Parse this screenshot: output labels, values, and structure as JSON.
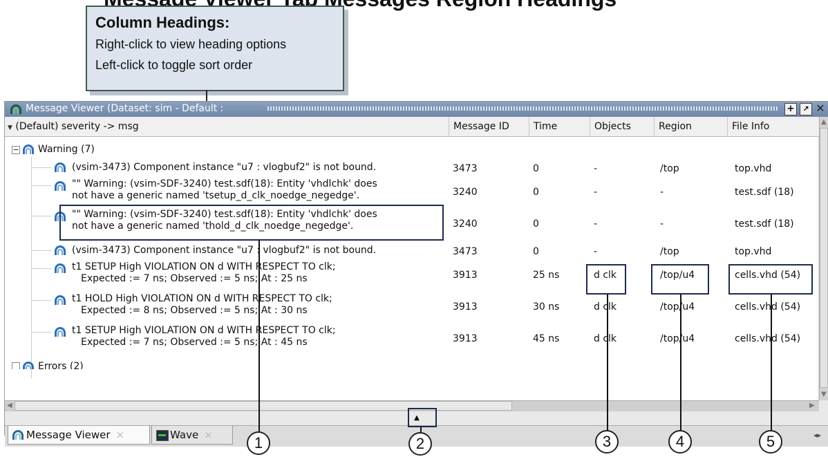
{
  "partial_heading": "Message Viewer Tab Messages Region Headings",
  "callout": {
    "title": "Column Headings:",
    "lines": [
      "Right-click to view heading options",
      "Left-click to toggle sort order"
    ]
  },
  "window": {
    "title": "Message Viewer (Dataset: sim - Default :",
    "buttons": {
      "add": "+",
      "restore": "↗",
      "close": "✕"
    }
  },
  "columns": [
    {
      "label": "(Default) severity -> msg"
    },
    {
      "label": "Message ID"
    },
    {
      "label": "Time"
    },
    {
      "label": "Objects"
    },
    {
      "label": "Region"
    },
    {
      "label": "File Info"
    }
  ],
  "group": {
    "label": "Warning (7)",
    "expanded": true
  },
  "rows": [
    {
      "msg": [
        "(vsim-3473) Component instance \"u7 : vlogbuf2\" is not bound."
      ],
      "id": "3473",
      "time": "0",
      "objects": "-",
      "region": "/top",
      "file": "top.vhd"
    },
    {
      "msg": [
        "\"\" Warning: (vsim-SDF-3240) test.sdf(18): Entity 'vhdlchk' does",
        "not have a generic named 'tsetup_d_clk_noedge_negedge'."
      ],
      "id": "3240",
      "time": "0",
      "objects": "-",
      "region": "-",
      "file": "test.sdf (18)"
    },
    {
      "msg": [
        "\"\" Warning: (vsim-SDF-3240) test.sdf(18): Entity 'vhdlchk' does",
        "not have a generic named 'thold_d_clk_noedge_negedge'."
      ],
      "id": "3240",
      "time": "0",
      "objects": "-",
      "region": "-",
      "file": "test.sdf (18)"
    },
    {
      "msg": [
        "(vsim-3473) Component instance \"u7 : vlogbuf2\" is not bound."
      ],
      "id": "3473",
      "time": "0",
      "objects": "-",
      "region": "/top",
      "file": "top.vhd"
    },
    {
      "msg": [
        "t1 SETUP High VIOLATION ON d WITH RESPECT TO clk;",
        "  Expected := 7 ns; Observed := 5 ns; At : 25 ns"
      ],
      "id": "3913",
      "time": "25 ns",
      "objects": "d clk",
      "region": "/top/u4",
      "file": "cells.vhd (54)"
    },
    {
      "msg": [
        "t1 HOLD High VIOLATION ON d WITH RESPECT TO clk;",
        "  Expected := 8 ns; Observed := 5 ns; At : 30 ns"
      ],
      "id": "3913",
      "time": "30 ns",
      "objects": "d clk",
      "region": "/top/u4",
      "file": "cells.vhd (54)"
    },
    {
      "msg": [
        "t1 SETUP High VIOLATION ON d WITH RESPECT TO clk;",
        "  Expected := 7 ns; Observed := 5 ns; At : 45 ns"
      ],
      "id": "3913",
      "time": "45 ns",
      "objects": "d clk",
      "region": "/top/u4",
      "file": "cells.vhd (54)"
    }
  ],
  "next_group_partial": "Errors (2)",
  "tabs": [
    {
      "label": "Message Viewer",
      "close": "×"
    },
    {
      "label": "Wave",
      "close": "×"
    }
  ],
  "tab_scroll": "◂▸",
  "expand_arrow": "▲",
  "annotations": [
    "1",
    "2",
    "3",
    "4",
    "5"
  ],
  "colors": {
    "titlebar": "#7890b0",
    "icon_blue": "#2f6fb7",
    "annotation_box": "#1b2b4a"
  }
}
